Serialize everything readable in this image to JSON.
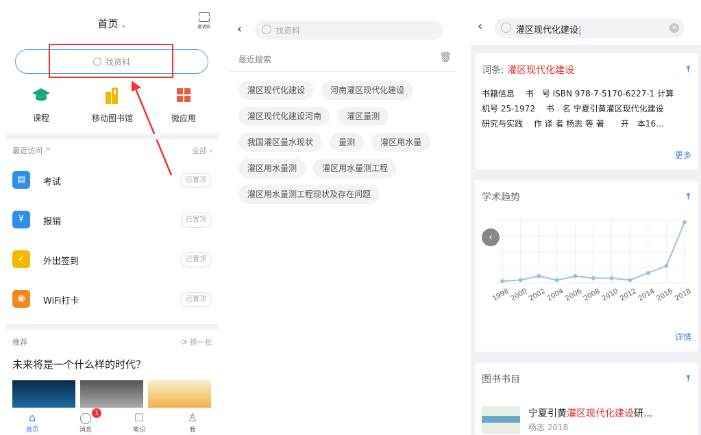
{
  "panel1": {
    "title": "首页",
    "scan_label": "邀请码",
    "search_placeholder": "找资料",
    "apps": [
      {
        "label": "课程",
        "icon": "graduation-cap-icon"
      },
      {
        "label": "移动图书馆",
        "icon": "library-icon"
      },
      {
        "label": "微应用",
        "icon": "grid-icon"
      }
    ],
    "recent_label": "最近访问",
    "all_label": "全部 ›",
    "visits": [
      {
        "label": "考试",
        "pin": "已置顶",
        "color": "#2e8fe6",
        "icon": "exam-icon"
      },
      {
        "label": "报销",
        "pin": "已置顶",
        "color": "#2e8fe6",
        "icon": "money-bag-icon"
      },
      {
        "label": "外出签到",
        "pin": "已置顶",
        "color": "#f5b800",
        "icon": "check-circle-icon"
      },
      {
        "label": "WiFi打卡",
        "pin": "已置顶",
        "color": "#f08a1c",
        "icon": "wifi-icon"
      }
    ],
    "recommend_label": "推荐",
    "refresh_label": "换一批",
    "recommend_title": "未来将是一个什么样的时代？",
    "tabs": [
      {
        "label": "首页",
        "icon": "home-icon",
        "active": true
      },
      {
        "label": "消息",
        "icon": "message-icon",
        "badge": "1"
      },
      {
        "label": "笔记",
        "icon": "note-icon"
      },
      {
        "label": "我",
        "icon": "person-icon"
      }
    ]
  },
  "panel2": {
    "search_placeholder": "找资料",
    "recent_label": "最近搜索",
    "chips": [
      "灌区现代化建设",
      "河南灌区现代化建设",
      "灌区现代化建设河南",
      "灌区量测",
      "我国灌区量水现状",
      "量测",
      "灌区用水量",
      "灌区用水量测",
      "灌区用水量测工程",
      "灌区用水量测工程现状及存在问题"
    ]
  },
  "panel3": {
    "search_value": "灌区现代化建设",
    "entry_prefix": "词条: ",
    "entry_term": "灌区现代化建设",
    "book_lines": [
      "书籍信息　 书　号 ISBN 978-7-5170-6227-1 计算",
      "机号 25-1972　 书　名 宁夏引黄灌区现代化建设",
      "研究与实践　 作 译 者 杨志 等 著　　开　本16…"
    ],
    "more_label": "更多",
    "trend_title": "学术趋势",
    "detail_label": "详情",
    "catalog_title": "图书书目",
    "book_title_prefix": "宁夏引黄",
    "book_title_hl": "灌区现代化建设",
    "book_title_suffix": "研...",
    "book_author": "杨志  2018",
    "accent": "#2f86e3",
    "highlight": "#e03030"
  },
  "chart_data": {
    "type": "line",
    "x": [
      "1998",
      "2000",
      "2002",
      "2004",
      "2006",
      "2008",
      "2010",
      "2012",
      "2014",
      "2016",
      "2018"
    ],
    "y": [
      2,
      3,
      7,
      3,
      7,
      5,
      5,
      3,
      10,
      17,
      60
    ],
    "categories": [
      "1998",
      "2000",
      "2002",
      "2004",
      "2006",
      "2008",
      "2010",
      "2012",
      "2014",
      "2016",
      "2018"
    ],
    "grid": true
  }
}
